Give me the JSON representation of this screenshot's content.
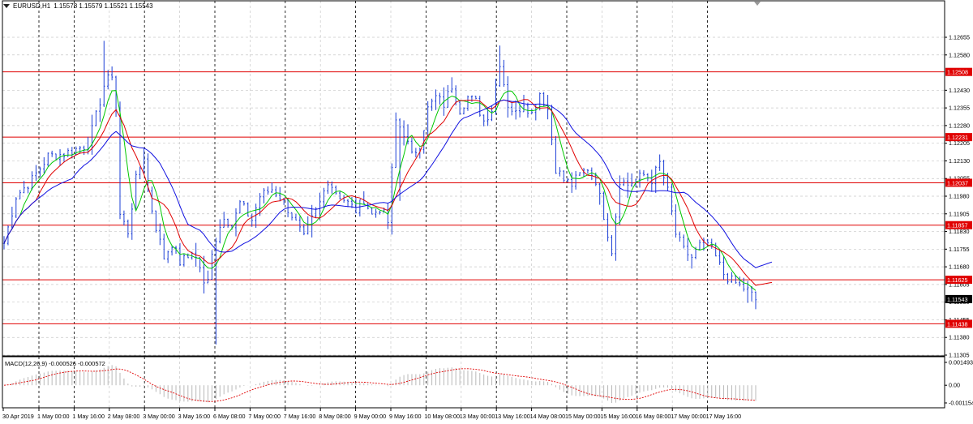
{
  "header": {
    "symbol": "EURUSD,H1",
    "ohlc": "1.15578 1.15579 1.15521 1.15543"
  },
  "macd": {
    "label": "MACD(12,26,9) -0.000526 -0.000572",
    "ticks": [
      "0.001493",
      "0.00",
      "-0.001154"
    ]
  },
  "colors": {
    "price": "#1c3fd6",
    "ma_fast": "#00c800",
    "ma_mid": "#e00000",
    "ma_slow": "#1010e0",
    "level": "#e00000",
    "grid": "#c8c8c8",
    "current": "#000000"
  },
  "chart_data": {
    "type": "line",
    "title": "EURUSD,H1",
    "y_ticks": [
      "1.12655",
      "1.12580",
      "1.12430",
      "1.12355",
      "1.12280",
      "1.12205",
      "1.12130",
      "1.12055",
      "1.11980",
      "1.11905",
      "1.11830",
      "1.11755",
      "1.11680",
      "1.11605",
      "1.11530",
      "1.11455",
      "1.11380",
      "1.11305"
    ],
    "ylim": [
      1.11305,
      1.12705
    ],
    "levels": [
      {
        "label": "1.12508",
        "value": 1.12508
      },
      {
        "label": "1.12231",
        "value": 1.12231
      },
      {
        "label": "1.12037",
        "value": 1.12037
      },
      {
        "label": "1.11857",
        "value": 1.11857
      },
      {
        "label": "1.11625",
        "value": 1.11625
      },
      {
        "label": "1.11438",
        "value": 1.11438
      }
    ],
    "current_price": {
      "label": "1.11543",
      "value": 1.11543
    },
    "x_labels": [
      "30 Apr 2019",
      "1 May 00:00",
      "1 May 16:00",
      "2 May 08:00",
      "3 May 00:00",
      "3 May 16:00",
      "6 May 08:00",
      "7 May 00:00",
      "7 May 16:00",
      "8 May 08:00",
      "9 May 00:00",
      "9 May 16:00",
      "10 May 08:00",
      "13 May 00:00",
      "13 May 16:00",
      "14 May 08:00",
      "15 May 00:00",
      "15 May 16:00",
      "16 May 08:00",
      "17 May 00:00",
      "17 May 16:00"
    ],
    "price_anchors": [
      [
        0,
        1.1178
      ],
      [
        3,
        1.1198
      ],
      [
        7,
        1.1205
      ],
      [
        11,
        1.1215
      ],
      [
        15,
        1.1216
      ],
      [
        18,
        1.1218
      ],
      [
        21,
        1.122
      ],
      [
        23,
        1.1232
      ],
      [
        25,
        1.1245
      ],
      [
        27,
        1.125
      ],
      [
        28,
        1.1235
      ],
      [
        29,
        1.119
      ],
      [
        31,
        1.1183
      ],
      [
        33,
        1.1205
      ],
      [
        35,
        1.1215
      ],
      [
        36,
        1.12
      ],
      [
        38,
        1.1185
      ],
      [
        40,
        1.1172
      ],
      [
        42,
        1.1178
      ],
      [
        44,
        1.117
      ],
      [
        46,
        1.1172
      ],
      [
        47,
        1.1175
      ],
      [
        49,
        1.1168
      ],
      [
        50,
        1.116
      ],
      [
        51,
        1.1162
      ],
      [
        52,
        1.1175
      ],
      [
        53,
        1.118
      ],
      [
        55,
        1.119
      ],
      [
        57,
        1.1185
      ],
      [
        59,
        1.1195
      ],
      [
        62,
        1.1188
      ],
      [
        64,
        1.1198
      ],
      [
        67,
        1.1201
      ],
      [
        69,
        1.1198
      ],
      [
        72,
        1.119
      ],
      [
        75,
        1.118
      ],
      [
        77,
        1.1188
      ],
      [
        79,
        1.1195
      ],
      [
        81,
        1.1205
      ],
      [
        83,
        1.12
      ],
      [
        86,
        1.1195
      ],
      [
        88,
        1.1192
      ],
      [
        90,
        1.1197
      ],
      [
        92,
        1.119
      ],
      [
        94,
        1.1193
      ],
      [
        96,
        1.1187
      ],
      [
        98,
        1.123
      ],
      [
        100,
        1.1225
      ],
      [
        102,
        1.1215
      ],
      [
        104,
        1.122
      ],
      [
        106,
        1.1235
      ],
      [
        108,
        1.124
      ],
      [
        110,
        1.1237
      ],
      [
        112,
        1.1245
      ],
      [
        114,
        1.1235
      ],
      [
        116,
        1.124
      ],
      [
        118,
        1.1238
      ],
      [
        120,
        1.123
      ],
      [
        122,
        1.1235
      ],
      [
        124,
        1.1255
      ],
      [
        126,
        1.1237
      ],
      [
        128,
        1.1233
      ],
      [
        130,
        1.1238
      ],
      [
        132,
        1.1233
      ],
      [
        134,
        1.1242
      ],
      [
        136,
        1.1235
      ],
      [
        138,
        1.121
      ],
      [
        140,
        1.1205
      ],
      [
        142,
        1.1203
      ],
      [
        144,
        1.1207
      ],
      [
        146,
        1.121
      ],
      [
        148,
        1.1205
      ],
      [
        150,
        1.119
      ],
      [
        152,
        1.1175
      ],
      [
        154,
        1.1205
      ],
      [
        156,
        1.1203
      ],
      [
        158,
        1.1205
      ],
      [
        160,
        1.1207
      ],
      [
        162,
        1.1205
      ],
      [
        164,
        1.1212
      ],
      [
        166,
        1.12
      ],
      [
        168,
        1.1182
      ],
      [
        170,
        1.1175
      ],
      [
        172,
        1.1172
      ],
      [
        174,
        1.1177
      ],
      [
        176,
        1.1178
      ],
      [
        178,
        1.1172
      ],
      [
        180,
        1.1165
      ],
      [
        182,
        1.1162
      ],
      [
        184,
        1.116
      ],
      [
        186,
        1.1158
      ],
      [
        188,
        1.1154
      ]
    ]
  }
}
